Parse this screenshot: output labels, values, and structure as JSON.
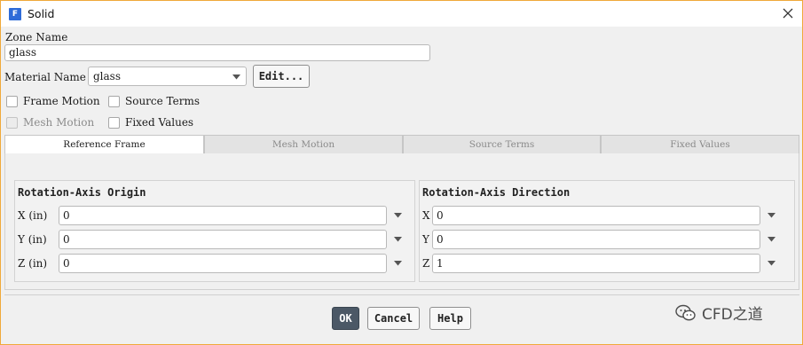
{
  "window": {
    "title": "Solid",
    "app_icon_letter": "F"
  },
  "zone": {
    "label": "Zone Name",
    "value": "glass"
  },
  "material": {
    "label": "Material Name",
    "value": "glass",
    "edit_label": "Edit..."
  },
  "options": {
    "frame_motion": "Frame Motion",
    "source_terms": "Source Terms",
    "mesh_motion": "Mesh Motion",
    "fixed_values": "Fixed Values"
  },
  "tabs": [
    {
      "label": "Reference Frame",
      "active": true
    },
    {
      "label": "Mesh Motion",
      "active": false
    },
    {
      "label": "Source Terms",
      "active": false
    },
    {
      "label": "Fixed Values",
      "active": false
    }
  ],
  "origin": {
    "title": "Rotation-Axis Origin",
    "fields": [
      {
        "label": "X (in)",
        "value": "0"
      },
      {
        "label": "Y (in)",
        "value": "0"
      },
      {
        "label": "Z (in)",
        "value": "0"
      }
    ]
  },
  "direction": {
    "title": "Rotation-Axis Direction",
    "fields": [
      {
        "label": "X",
        "value": "0"
      },
      {
        "label": "Y",
        "value": "0"
      },
      {
        "label": "Z",
        "value": "1"
      }
    ]
  },
  "buttons": {
    "ok": "OK",
    "cancel": "Cancel",
    "help": "Help"
  },
  "watermark": {
    "text": "CFD之道"
  },
  "colors": {
    "title_border": "#f0a93a",
    "ok_button": "#4b5866",
    "app_icon": "#2e6bd8"
  }
}
